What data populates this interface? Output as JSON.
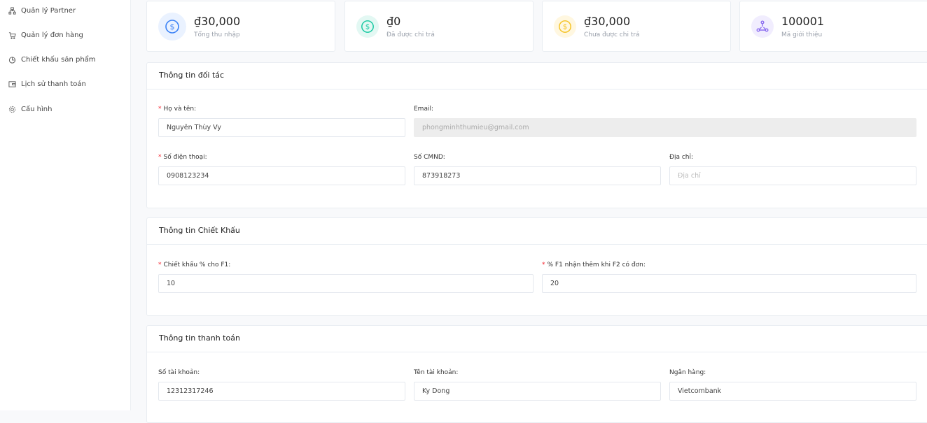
{
  "sidebar": {
    "items": [
      {
        "label": "Quản lý Partner",
        "icon": "sitemap-icon"
      },
      {
        "label": "Quản lý đơn hàng",
        "icon": "cart-icon"
      },
      {
        "label": "Chiết khấu sản phẩm",
        "icon": "pie-chart-icon"
      },
      {
        "label": "Lịch sử thanh toán",
        "icon": "wallet-icon"
      },
      {
        "label": "Cấu hình",
        "icon": "gear-icon"
      }
    ]
  },
  "stats": [
    {
      "value": "₫30,000",
      "label": "Tổng thu nhập",
      "color": "#3b82f6",
      "bg": "#eaf2ff"
    },
    {
      "value": "₫0",
      "label": "Đã được chi trả",
      "color": "#14c8a0",
      "bg": "#e3f8f3"
    },
    {
      "value": "₫30,000",
      "label": "Chưa được chi trả",
      "color": "#f5c220",
      "bg": "#fff7e0"
    },
    {
      "value": "100001",
      "label": "Mã giới thiệu",
      "color": "#8b6cf0",
      "bg": "#f1edfe"
    }
  ],
  "partner": {
    "title": "Thông tin đối tác",
    "name": {
      "label": "Họ và tên:",
      "value": "Nguyễn Thùy Vy"
    },
    "email": {
      "label": "Email:",
      "value": "phongminhthumieu@gmail.com"
    },
    "phone": {
      "label": "Số điện thoại:",
      "value": "0908123234"
    },
    "cmnd": {
      "label": "Số CMND:",
      "value": "873918273"
    },
    "address": {
      "label": "Địa chỉ:",
      "placeholder": "Địa chỉ"
    }
  },
  "discount": {
    "title": "Thông tin Chiết Khấu",
    "f1": {
      "label": "Chiết khấu % cho F1:",
      "value": "10"
    },
    "f2": {
      "label": "% F1 nhận thêm khi F2 có đơn:",
      "value": "20"
    }
  },
  "payment": {
    "title": "Thông tin thanh toán",
    "account_no": {
      "label": "Số tài khoản:",
      "value": "12312317246"
    },
    "account_name": {
      "label": "Tên tài khoản:",
      "value": "Ky Dong"
    },
    "bank": {
      "label": "Ngân hàng:",
      "value": "Vietcombank"
    }
  }
}
